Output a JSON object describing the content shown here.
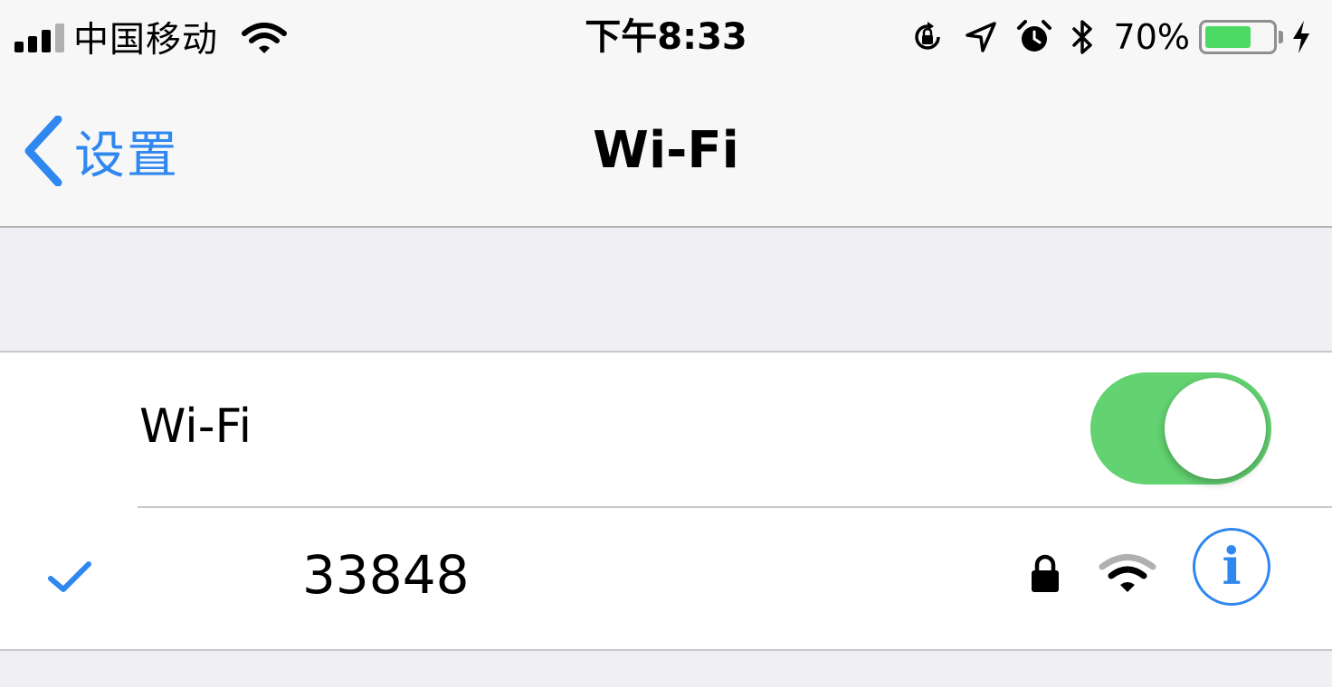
{
  "status_bar": {
    "carrier": "中国移动",
    "time": "下午8:33",
    "battery_percent_label": "70%",
    "battery_level": 0.7,
    "icons": [
      "signal-bars-icon",
      "wifi-icon",
      "orientation-lock-icon",
      "location-arrow-icon",
      "alarm-icon",
      "bluetooth-icon",
      "battery-icon",
      "charging-bolt-icon"
    ]
  },
  "nav": {
    "back_label": "设置",
    "title": "Wi-Fi"
  },
  "wifi_row": {
    "label": "Wi-Fi",
    "enabled": true
  },
  "network": {
    "name": "33848",
    "connected": true,
    "secured": true,
    "info_glyph": "i"
  },
  "colors": {
    "accent": "#2f88f0",
    "toggle_on": "#63d271",
    "battery": "#4cd964",
    "background": "#efeff4"
  }
}
